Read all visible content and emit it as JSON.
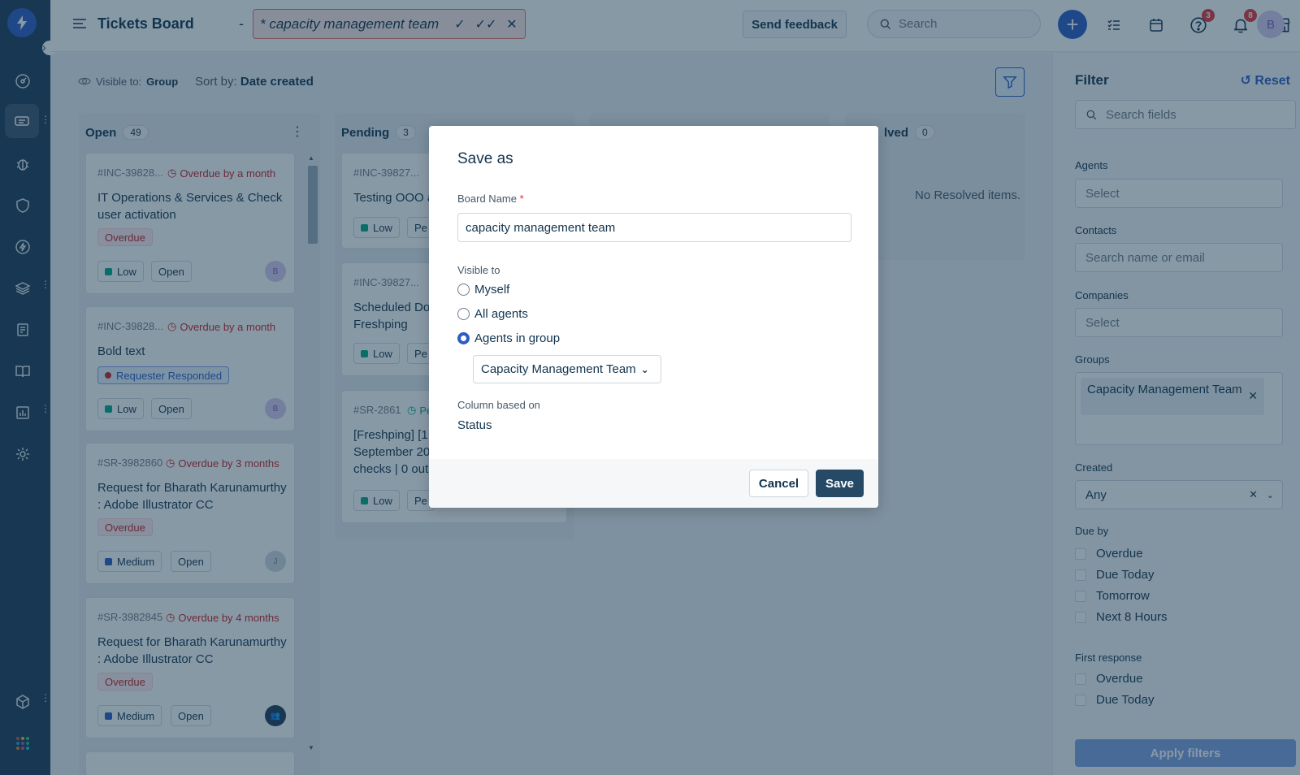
{
  "header": {
    "title": "Tickets Board",
    "dash": "-",
    "view_name": "* capacity management team",
    "feedback_label": "Send feedback",
    "search_placeholder": "Search",
    "help_badge": "3",
    "notif_badge": "8",
    "avatar_initial": "B"
  },
  "subbar": {
    "visible_label": "Visible to:",
    "visible_value": "Group",
    "sort_label": "Sort by:",
    "sort_value": "Date created"
  },
  "columns": {
    "open": {
      "title": "Open",
      "count": "49",
      "cards": [
        {
          "id": "#INC-39828...",
          "due": "Overdue by a month",
          "subject": "IT Operations & Services & Check user activation",
          "tag": "Overdue",
          "priority": "Low",
          "status": "Open",
          "avatar": "B"
        },
        {
          "id": "#INC-39828...",
          "due": "Overdue by a month",
          "subject": "Bold text",
          "tag": "Requester Responded",
          "priority": "Low",
          "status": "Open",
          "avatar": "B"
        },
        {
          "id": "#SR-3982860",
          "due": "Overdue by 3 months",
          "subject": "Request for Bharath Karunamurthy : Adobe Illustrator CC",
          "tag": "Overdue",
          "priority": "Medium",
          "status": "Open",
          "avatar": "J"
        },
        {
          "id": "#SR-3982845",
          "due": "Overdue by 4 months",
          "subject": "Request for Bharath Karunamurthy : Adobe Illustrator CC",
          "tag": "Overdue",
          "priority": "Medium",
          "status": "Open",
          "avatar": ""
        }
      ]
    },
    "pending": {
      "title": "Pending",
      "count": "3",
      "cards": [
        {
          "id": "#INC-39827...",
          "subject": "Testing OOO a",
          "priority": "Low",
          "status": "Pe"
        },
        {
          "id": "#INC-39827...",
          "subject": "Scheduled Do Freshping",
          "priority": "Low",
          "status": "Pe"
        },
        {
          "id": "#SR-2861",
          "due": "Pe",
          "subject": "[Freshping] [1 September 20 checks | 0 outa",
          "priority": "Low",
          "status": "Pe"
        }
      ]
    },
    "resolved": {
      "title": "lved",
      "count": "0",
      "empty": "No Resolved items."
    }
  },
  "filter_panel": {
    "title": "Filter",
    "reset_label": "Reset",
    "search_placeholder": "Search fields",
    "agents_label": "Agents",
    "agents_placeholder": "Select",
    "contacts_label": "Contacts",
    "contacts_placeholder": "Search name or email",
    "companies_label": "Companies",
    "companies_placeholder": "Select",
    "groups_label": "Groups",
    "group_chip": "Capacity Management Team",
    "created_label": "Created",
    "created_value": "Any",
    "dueby_label": "Due by",
    "dueby_options": [
      "Overdue",
      "Due Today",
      "Tomorrow",
      "Next 8 Hours"
    ],
    "firstresp_label": "First response",
    "firstresp_options": [
      "Overdue",
      "Due Today"
    ],
    "apply_label": "Apply filters"
  },
  "modal": {
    "title": "Save as",
    "board_name_label": "Board Name",
    "required_mark": "*",
    "board_name_value": "capacity management team",
    "visible_to_label": "Visible to",
    "options": [
      "Myself",
      "All agents",
      "Agents in group"
    ],
    "selected_option": "Agents in group",
    "group_value": "Capacity Management Team",
    "column_based_label": "Column based on",
    "column_based_value": "Status",
    "cancel_label": "Cancel",
    "save_label": "Save"
  },
  "colors": {
    "rail": "#1c3b57",
    "accent": "#2c5cc5",
    "save_button": "#264966",
    "overdue": "#c82124",
    "low": "#00a886",
    "medium": "#2c5cc5"
  }
}
